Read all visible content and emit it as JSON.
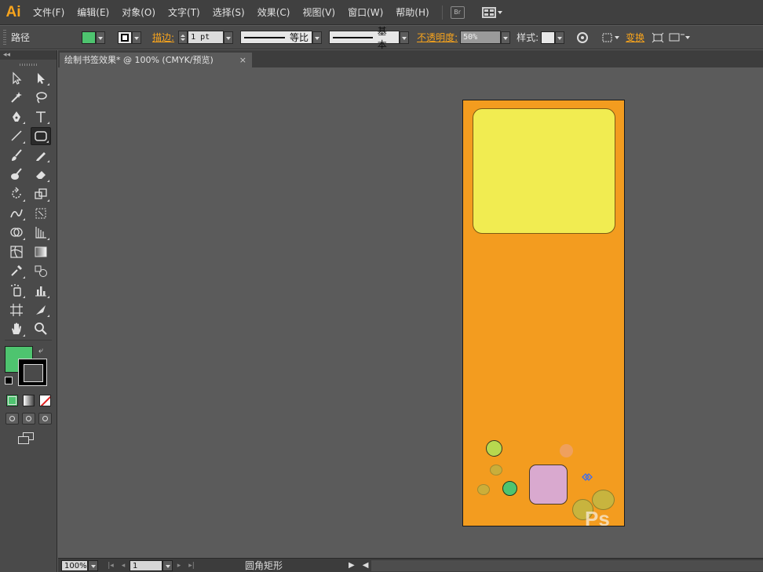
{
  "app": {
    "logo": "Ai"
  },
  "menu": {
    "items": [
      "文件(F)",
      "编辑(E)",
      "对象(O)",
      "文字(T)",
      "选择(S)",
      "效果(C)",
      "视图(V)",
      "窗口(W)",
      "帮助(H)"
    ],
    "bridge_label": "Br"
  },
  "control": {
    "selection_type": "路径",
    "fill_color": "#4ec46f",
    "stroke_label": "描边:",
    "stroke_weight": "1 pt",
    "profile_label": "等比",
    "brush_label": "基本",
    "opacity_label": "不透明度:",
    "opacity_value": "50%",
    "style_label": "样式:",
    "transform_label": "变换"
  },
  "document": {
    "tab_title": "绘制书签效果* @ 100% (CMYK/预览)",
    "close_glyph": "×"
  },
  "toolbox": {
    "collapse_glyph": "◂◂",
    "fill_color": "#4ec46f",
    "stroke_color": "#000000"
  },
  "artwork": {
    "artboard_color": "#f39c1f",
    "panel_color": "#f1ec51",
    "tile_color": "#d9a9cf",
    "watermark": "Ps"
  },
  "status": {
    "zoom": "100%",
    "page": "1",
    "current_tool": "圆角矩形"
  }
}
